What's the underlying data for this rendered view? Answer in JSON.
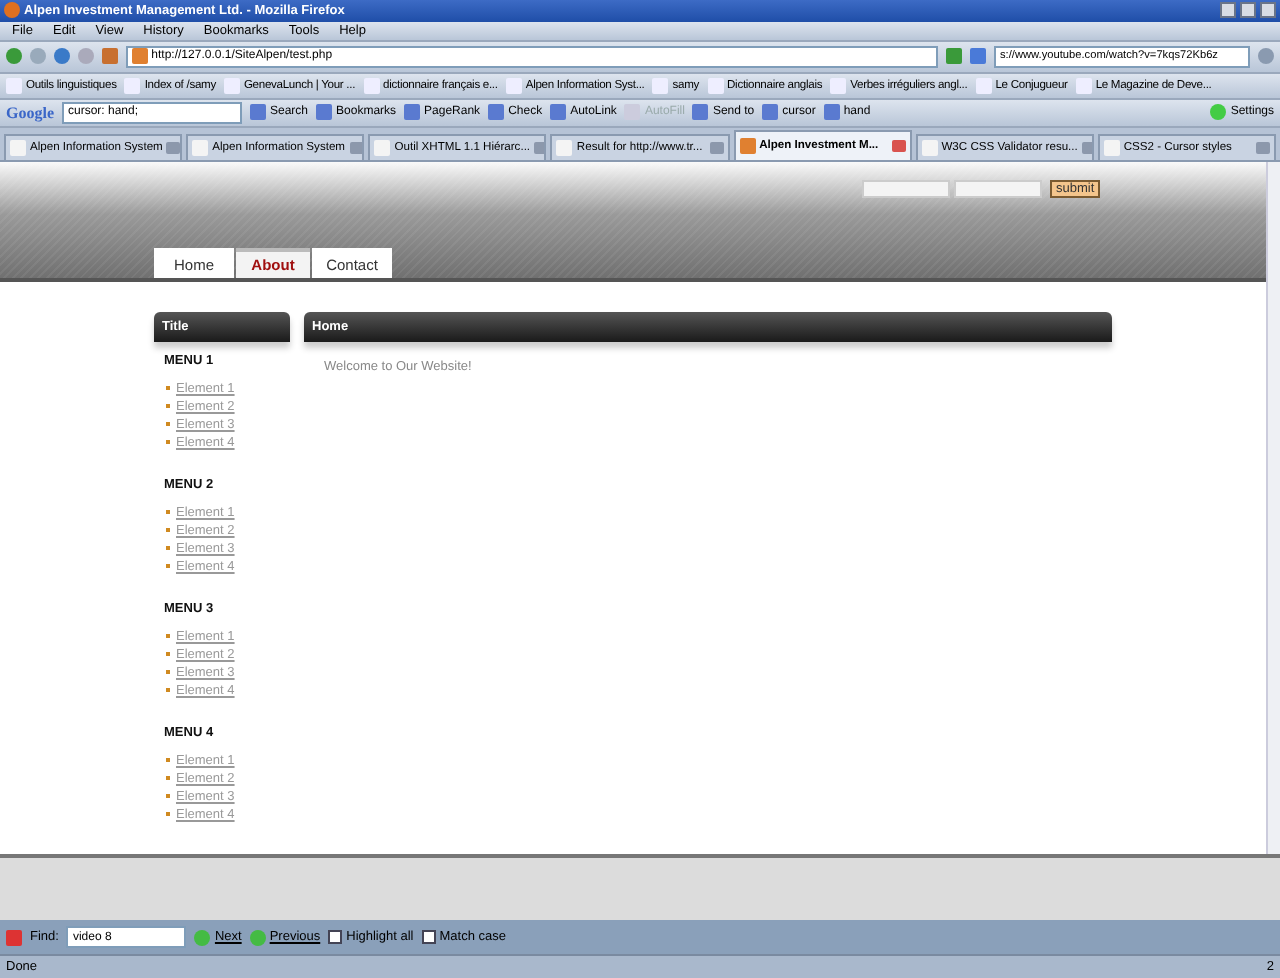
{
  "window": {
    "title": "Alpen Investment Management Ltd. - Mozilla Firefox"
  },
  "menu": [
    "File",
    "Edit",
    "View",
    "History",
    "Bookmarks",
    "Tools",
    "Help"
  ],
  "nav": {
    "url": "http://127.0.0.1/SiteAlpen/test.php",
    "search_value": "s://www.youtube.com/watch?v=7kqs72Kb6z"
  },
  "bookmarks": [
    "Outils linguistiques",
    "Index of /samy",
    "GenevaLunch | Your ...",
    "dictionnaire français e...",
    "Alpen Information Syst...",
    "samy",
    "Dictionnaire anglais",
    "Verbes irréguliers angl...",
    "Le Conjugueur",
    "Le Magazine de Deve..."
  ],
  "google_toolbar": {
    "logo": "Google",
    "search_value": "cursor: hand;",
    "items": [
      {
        "label": "Search",
        "disabled": false
      },
      {
        "label": "Bookmarks",
        "disabled": false
      },
      {
        "label": "PageRank",
        "disabled": false
      },
      {
        "label": "Check",
        "disabled": false
      },
      {
        "label": "AutoLink",
        "disabled": false
      },
      {
        "label": "AutoFill",
        "disabled": true
      },
      {
        "label": "Send to",
        "disabled": false
      },
      {
        "label": "cursor",
        "disabled": false
      },
      {
        "label": "hand",
        "disabled": false
      }
    ],
    "settings": "Settings"
  },
  "tabs": [
    {
      "label": "Alpen Information System",
      "selected": false
    },
    {
      "label": "Alpen Information System",
      "selected": false
    },
    {
      "label": "Outil XHTML 1.1 Hiérarc...",
      "selected": false
    },
    {
      "label": "Result for http://www.tr...",
      "selected": false
    },
    {
      "label": "Alpen Investment M...",
      "selected": true
    },
    {
      "label": "W3C CSS Validator resu...",
      "selected": false
    },
    {
      "label": "CSS2 - Cursor styles",
      "selected": false
    }
  ],
  "page": {
    "submit": "submit",
    "nav": [
      {
        "label": "Home",
        "selected": false
      },
      {
        "label": "About",
        "selected": true
      },
      {
        "label": "Contact",
        "selected": false
      }
    ],
    "sidebar": {
      "title": "Title",
      "menus": [
        {
          "title": "MENU 1",
          "items": [
            "Element 1",
            "Element 2",
            "Element 3",
            "Element 4"
          ]
        },
        {
          "title": "MENU 2",
          "items": [
            "Element 1",
            "Element 2",
            "Element 3",
            "Element 4"
          ]
        },
        {
          "title": "MENU 3",
          "items": [
            "Element 1",
            "Element 2",
            "Element 3",
            "Element 4"
          ]
        },
        {
          "title": "MENU 4",
          "items": [
            "Element 1",
            "Element 2",
            "Element 3",
            "Element 4"
          ]
        }
      ]
    },
    "main": {
      "title": "Home",
      "text": "Welcome to Our Website!"
    }
  },
  "find_bar": {
    "label": "Find:",
    "value": "video 8",
    "next": "Next",
    "previous": "Previous",
    "options": [
      {
        "label": "Highlight all",
        "checked": false
      },
      {
        "label": "Match case",
        "checked": false
      }
    ]
  },
  "status_bar": {
    "text": "Done",
    "count": "2"
  }
}
